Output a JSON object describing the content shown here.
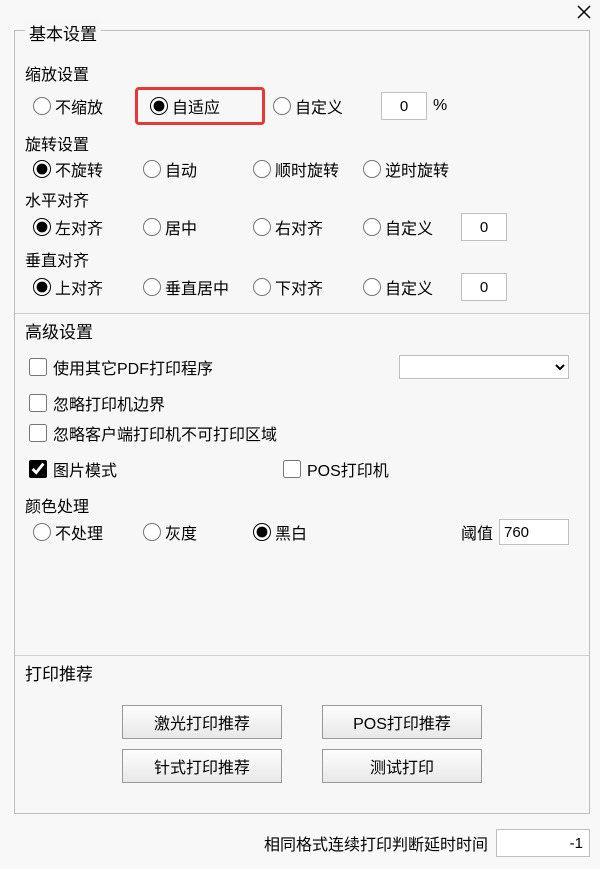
{
  "titlebar": {
    "close": "×"
  },
  "basic": {
    "title": "基本设置",
    "scale": {
      "label": "缩放设置",
      "none": "不缩放",
      "fit": "自适应",
      "custom": "自定义",
      "value": "0",
      "unit": "%"
    },
    "rotate": {
      "label": "旋转设置",
      "none": "不旋转",
      "auto": "自动",
      "cw": "顺时旋转",
      "ccw": "逆时旋转"
    },
    "halign": {
      "label": "水平对齐",
      "left": "左对齐",
      "center": "居中",
      "right": "右对齐",
      "custom": "自定义",
      "value": "0"
    },
    "valign": {
      "label": "垂直对齐",
      "top": "上对齐",
      "center": "垂直居中",
      "bottom": "下对齐",
      "custom": "自定义",
      "value": "0"
    }
  },
  "advanced": {
    "title": "高级设置",
    "use_other_pdf": "使用其它PDF打印程序",
    "ignore_printer_margin": "忽略打印机边界",
    "ignore_client_unprintable": "忽略客户端打印机不可打印区域",
    "image_mode": "图片模式",
    "pos_printer": "POS打印机",
    "color": {
      "label": "颜色处理",
      "none": "不处理",
      "gray": "灰度",
      "bw": "黑白",
      "threshold_label": "阈值",
      "threshold_value": "760"
    }
  },
  "recommend": {
    "title": "打印推荐",
    "laser": "激光打印推荐",
    "pos": "POS打印推荐",
    "dot": "针式打印推荐",
    "test": "测试打印"
  },
  "footer": {
    "label": "相同格式连续打印判断延时时间",
    "value": "-1"
  }
}
